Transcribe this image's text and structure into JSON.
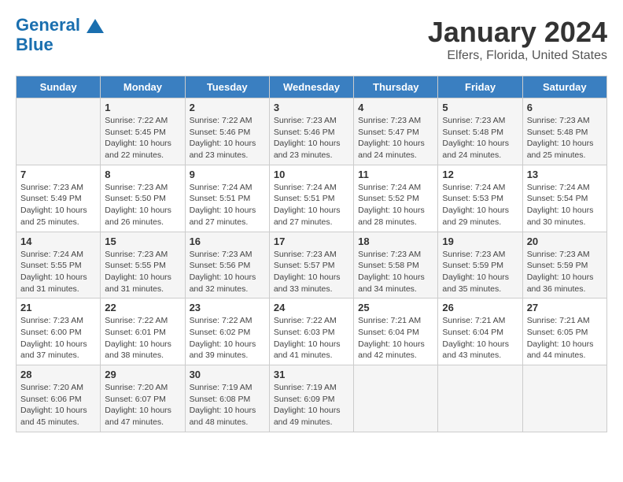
{
  "header": {
    "logo_line1": "General",
    "logo_line2": "Blue",
    "title": "January 2024",
    "subtitle": "Elfers, Florida, United States"
  },
  "days_of_week": [
    "Sunday",
    "Monday",
    "Tuesday",
    "Wednesday",
    "Thursday",
    "Friday",
    "Saturday"
  ],
  "weeks": [
    [
      {
        "day": "",
        "info": ""
      },
      {
        "day": "1",
        "info": "Sunrise: 7:22 AM\nSunset: 5:45 PM\nDaylight: 10 hours\nand 22 minutes."
      },
      {
        "day": "2",
        "info": "Sunrise: 7:22 AM\nSunset: 5:46 PM\nDaylight: 10 hours\nand 23 minutes."
      },
      {
        "day": "3",
        "info": "Sunrise: 7:23 AM\nSunset: 5:46 PM\nDaylight: 10 hours\nand 23 minutes."
      },
      {
        "day": "4",
        "info": "Sunrise: 7:23 AM\nSunset: 5:47 PM\nDaylight: 10 hours\nand 24 minutes."
      },
      {
        "day": "5",
        "info": "Sunrise: 7:23 AM\nSunset: 5:48 PM\nDaylight: 10 hours\nand 24 minutes."
      },
      {
        "day": "6",
        "info": "Sunrise: 7:23 AM\nSunset: 5:48 PM\nDaylight: 10 hours\nand 25 minutes."
      }
    ],
    [
      {
        "day": "7",
        "info": "Sunrise: 7:23 AM\nSunset: 5:49 PM\nDaylight: 10 hours\nand 25 minutes."
      },
      {
        "day": "8",
        "info": "Sunrise: 7:23 AM\nSunset: 5:50 PM\nDaylight: 10 hours\nand 26 minutes."
      },
      {
        "day": "9",
        "info": "Sunrise: 7:24 AM\nSunset: 5:51 PM\nDaylight: 10 hours\nand 27 minutes."
      },
      {
        "day": "10",
        "info": "Sunrise: 7:24 AM\nSunset: 5:51 PM\nDaylight: 10 hours\nand 27 minutes."
      },
      {
        "day": "11",
        "info": "Sunrise: 7:24 AM\nSunset: 5:52 PM\nDaylight: 10 hours\nand 28 minutes."
      },
      {
        "day": "12",
        "info": "Sunrise: 7:24 AM\nSunset: 5:53 PM\nDaylight: 10 hours\nand 29 minutes."
      },
      {
        "day": "13",
        "info": "Sunrise: 7:24 AM\nSunset: 5:54 PM\nDaylight: 10 hours\nand 30 minutes."
      }
    ],
    [
      {
        "day": "14",
        "info": "Sunrise: 7:24 AM\nSunset: 5:55 PM\nDaylight: 10 hours\nand 31 minutes."
      },
      {
        "day": "15",
        "info": "Sunrise: 7:23 AM\nSunset: 5:55 PM\nDaylight: 10 hours\nand 31 minutes."
      },
      {
        "day": "16",
        "info": "Sunrise: 7:23 AM\nSunset: 5:56 PM\nDaylight: 10 hours\nand 32 minutes."
      },
      {
        "day": "17",
        "info": "Sunrise: 7:23 AM\nSunset: 5:57 PM\nDaylight: 10 hours\nand 33 minutes."
      },
      {
        "day": "18",
        "info": "Sunrise: 7:23 AM\nSunset: 5:58 PM\nDaylight: 10 hours\nand 34 minutes."
      },
      {
        "day": "19",
        "info": "Sunrise: 7:23 AM\nSunset: 5:59 PM\nDaylight: 10 hours\nand 35 minutes."
      },
      {
        "day": "20",
        "info": "Sunrise: 7:23 AM\nSunset: 5:59 PM\nDaylight: 10 hours\nand 36 minutes."
      }
    ],
    [
      {
        "day": "21",
        "info": "Sunrise: 7:23 AM\nSunset: 6:00 PM\nDaylight: 10 hours\nand 37 minutes."
      },
      {
        "day": "22",
        "info": "Sunrise: 7:22 AM\nSunset: 6:01 PM\nDaylight: 10 hours\nand 38 minutes."
      },
      {
        "day": "23",
        "info": "Sunrise: 7:22 AM\nSunset: 6:02 PM\nDaylight: 10 hours\nand 39 minutes."
      },
      {
        "day": "24",
        "info": "Sunrise: 7:22 AM\nSunset: 6:03 PM\nDaylight: 10 hours\nand 41 minutes."
      },
      {
        "day": "25",
        "info": "Sunrise: 7:21 AM\nSunset: 6:04 PM\nDaylight: 10 hours\nand 42 minutes."
      },
      {
        "day": "26",
        "info": "Sunrise: 7:21 AM\nSunset: 6:04 PM\nDaylight: 10 hours\nand 43 minutes."
      },
      {
        "day": "27",
        "info": "Sunrise: 7:21 AM\nSunset: 6:05 PM\nDaylight: 10 hours\nand 44 minutes."
      }
    ],
    [
      {
        "day": "28",
        "info": "Sunrise: 7:20 AM\nSunset: 6:06 PM\nDaylight: 10 hours\nand 45 minutes."
      },
      {
        "day": "29",
        "info": "Sunrise: 7:20 AM\nSunset: 6:07 PM\nDaylight: 10 hours\nand 47 minutes."
      },
      {
        "day": "30",
        "info": "Sunrise: 7:19 AM\nSunset: 6:08 PM\nDaylight: 10 hours\nand 48 minutes."
      },
      {
        "day": "31",
        "info": "Sunrise: 7:19 AM\nSunset: 6:09 PM\nDaylight: 10 hours\nand 49 minutes."
      },
      {
        "day": "",
        "info": ""
      },
      {
        "day": "",
        "info": ""
      },
      {
        "day": "",
        "info": ""
      }
    ]
  ]
}
